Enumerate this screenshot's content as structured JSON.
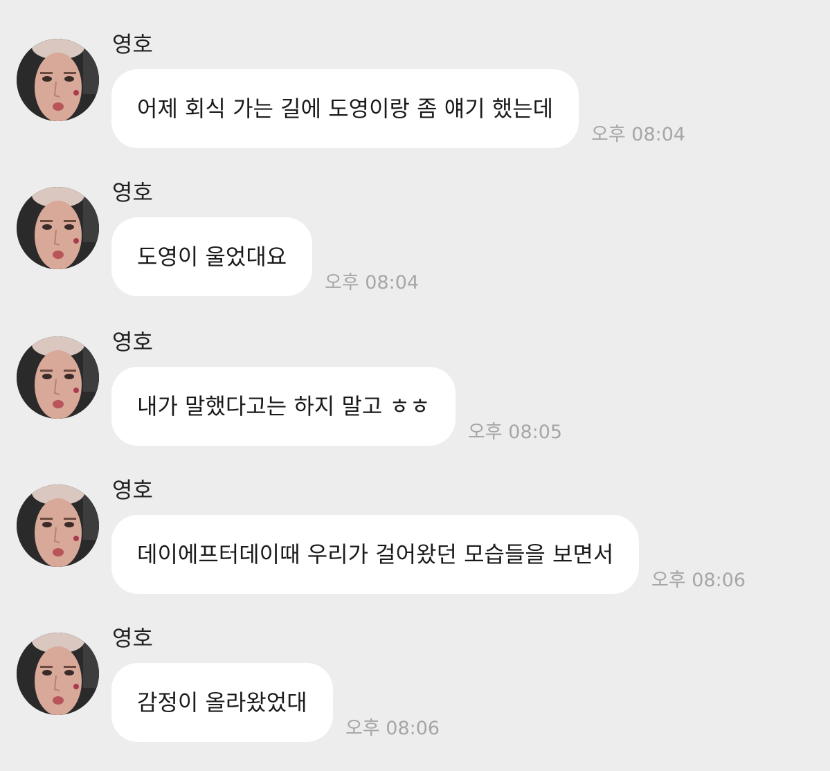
{
  "colors": {
    "background": "#ededed",
    "bubble": "#ffffff",
    "text": "#1a1a1a",
    "timestamp": "#a6a6a6"
  },
  "messages": [
    {
      "sender": "영호",
      "text": "어제 회식 가는 길에 도영이랑 좀 얘기 했는데",
      "time": "오후 08:04",
      "avatar": "profile-photo"
    },
    {
      "sender": "영호",
      "text": "도영이 울었대요",
      "time": "오후 08:04",
      "avatar": "profile-photo"
    },
    {
      "sender": "영호",
      "text": "내가 말했다고는 하지 말고 ㅎㅎ",
      "time": "오후 08:05",
      "avatar": "profile-photo"
    },
    {
      "sender": "영호",
      "text": "데이에프터데이때 우리가 걸어왔던 모습들을 보면서",
      "time": "오후 08:06",
      "avatar": "profile-photo"
    },
    {
      "sender": "영호",
      "text": "감정이 올라왔었대",
      "time": "오후 08:06",
      "avatar": "profile-photo"
    }
  ]
}
